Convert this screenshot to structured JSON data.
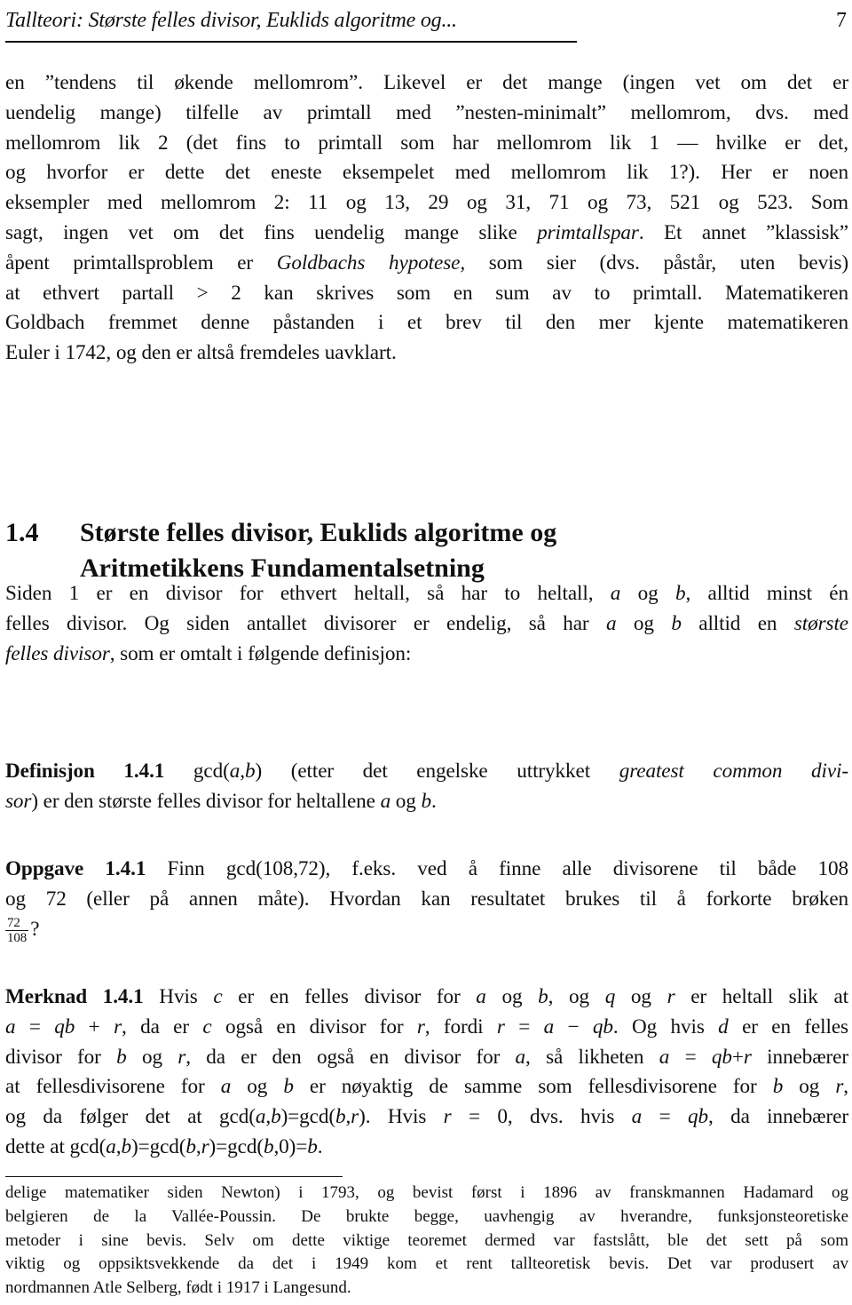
{
  "header": {
    "running_title": "Tallteori: Største felles divisor, Euklids algoritme og...",
    "page_number": "7"
  },
  "intro": {
    "lines": [
      "en ”tendens til økende mellomrom”. Likevel er det mange (ingen vet om det er",
      "uendelig mange) tilfelle av primtall med ”nesten-minimalt” mellomrom, dvs. med",
      "mellomrom lik 2 (det fins to primtall som har mellomrom lik 1 — hvilke er det,",
      "og hvorfor er dette det eneste eksempelet med mellomrom lik 1?). Her er noen",
      "eksempler med mellomrom 2: 11 og 13, 29 og 31, 71 og 73, 521 og 523. Som"
    ],
    "line6_a": "sagt, ingen vet om det fins uendelig mange slike ",
    "line6_em": "primtallspar",
    "line6_b": ". Et annet ”klassisk”",
    "line7_a": "åpent primtallsproblem er ",
    "line7_em": "Goldbachs hypotese,",
    "line7_b": " som sier (dvs. påstår, uten bevis)",
    "line8": "at ethvert partall > 2 kan skrives som en sum av to primtall. Matematikeren",
    "line9": "Goldbach fremmet denne påstanden i et brev til den mer kjente matematikeren",
    "line10": "Euler i 1742, og den er altså fremdeles uavklart."
  },
  "section": {
    "number": "1.4",
    "title_line1": "Største felles divisor, Euklids algoritme og",
    "title_line2": "Aritmetikkens Fundamentalsetning"
  },
  "section_intro": {
    "l1_a": "Siden 1 er en divisor for ethvert heltall, så har to heltall, ",
    "l1_var_a": "a",
    "l1_og": " og ",
    "l1_var_b": "b",
    "l1_b": ", alltid minst én",
    "l2_a": "felles divisor. Og siden antallet divisorer er endelig, så har ",
    "l2_var_a": "a",
    "l2_og": " og ",
    "l2_var_b": "b",
    "l2_b": " alltid en ",
    "l2_em": "største",
    "l3_em": "felles divisor",
    "l3_b": ", som er omtalt i følgende definisjon:"
  },
  "definition": {
    "label": "Definisjon 1.4.1",
    "gcd_prefix": " gcd(",
    "var_a": "a",
    "comma": ",",
    "var_b": "b",
    "text_a": ") (etter det engelske uttrykket ",
    "em1": "greatest common divi-",
    "em2": "sor",
    "text_b": ") er den største felles divisor for heltallene ",
    "var_a2": "a",
    "og": " og ",
    "var_b2": "b",
    "end": "."
  },
  "exercise": {
    "label": "Oppgave 1.4.1",
    "l1": " Finn gcd(108,72), f.eks. ved å finne alle divisorene til både 108",
    "l2": "og 72 (eller på annen måte). Hvordan kan resultatet brukes til å forkorte brøken",
    "frac_num": "72",
    "frac_den": "108",
    "end": "?"
  },
  "remark": {
    "label": "Merknad 1.4.1",
    "lines": [
      " Hvis <i>c</i> er en felles divisor for <i>a</i> og <i>b</i>, og <i>q</i> og <i>r</i> er heltall slik at",
      "<i>a</i> = <i>qb</i> + <i>r</i>, da er <i>c</i> også en divisor for <i>r</i>, fordi <i>r</i> = <i>a</i> − <i>qb</i>. Og hvis <i>d</i> er en felles",
      "divisor for <i>b</i> og <i>r</i>, da er den også en divisor for <i>a</i>, så likheten <i>a</i> = <i>qb</i>+<i>r</i> innebærer",
      "at fellesdivisorene for <i>a</i> og <i>b</i> er nøyaktig de samme som fellesdivisorene for <i>b</i> og <i>r</i>,",
      "og da følger det at gcd(<i>a</i>,<i>b</i>)=gcd(<i>b</i>,<i>r</i>). Hvis <i>r</i> = 0, dvs. hvis <i>a</i> = <i>qb</i>, da innebærer",
      "dette at gcd(<i>a</i>,<i>b</i>)=gcd(<i>b</i>,<i>r</i>)=gcd(<i>b</i>,0)=<i>b</i>."
    ]
  },
  "footnote": {
    "lines": [
      "delige matematiker siden Newton) i 1793, og bevist først i 1896 av franskmannen Hadamard og",
      "belgieren de la Vallée-Poussin. De brukte begge, uavhengig av hverandre, funksjonsteoretiske",
      "metoder i sine bevis. Selv om dette viktige teoremet dermed var fastslått, ble det sett på som",
      "viktig og oppsiktsvekkende da det i 1949 kom et rent tallteoretisk bevis. Det var produsert av",
      "nordmannen Atle Selberg, født i 1917 i Langesund."
    ]
  }
}
